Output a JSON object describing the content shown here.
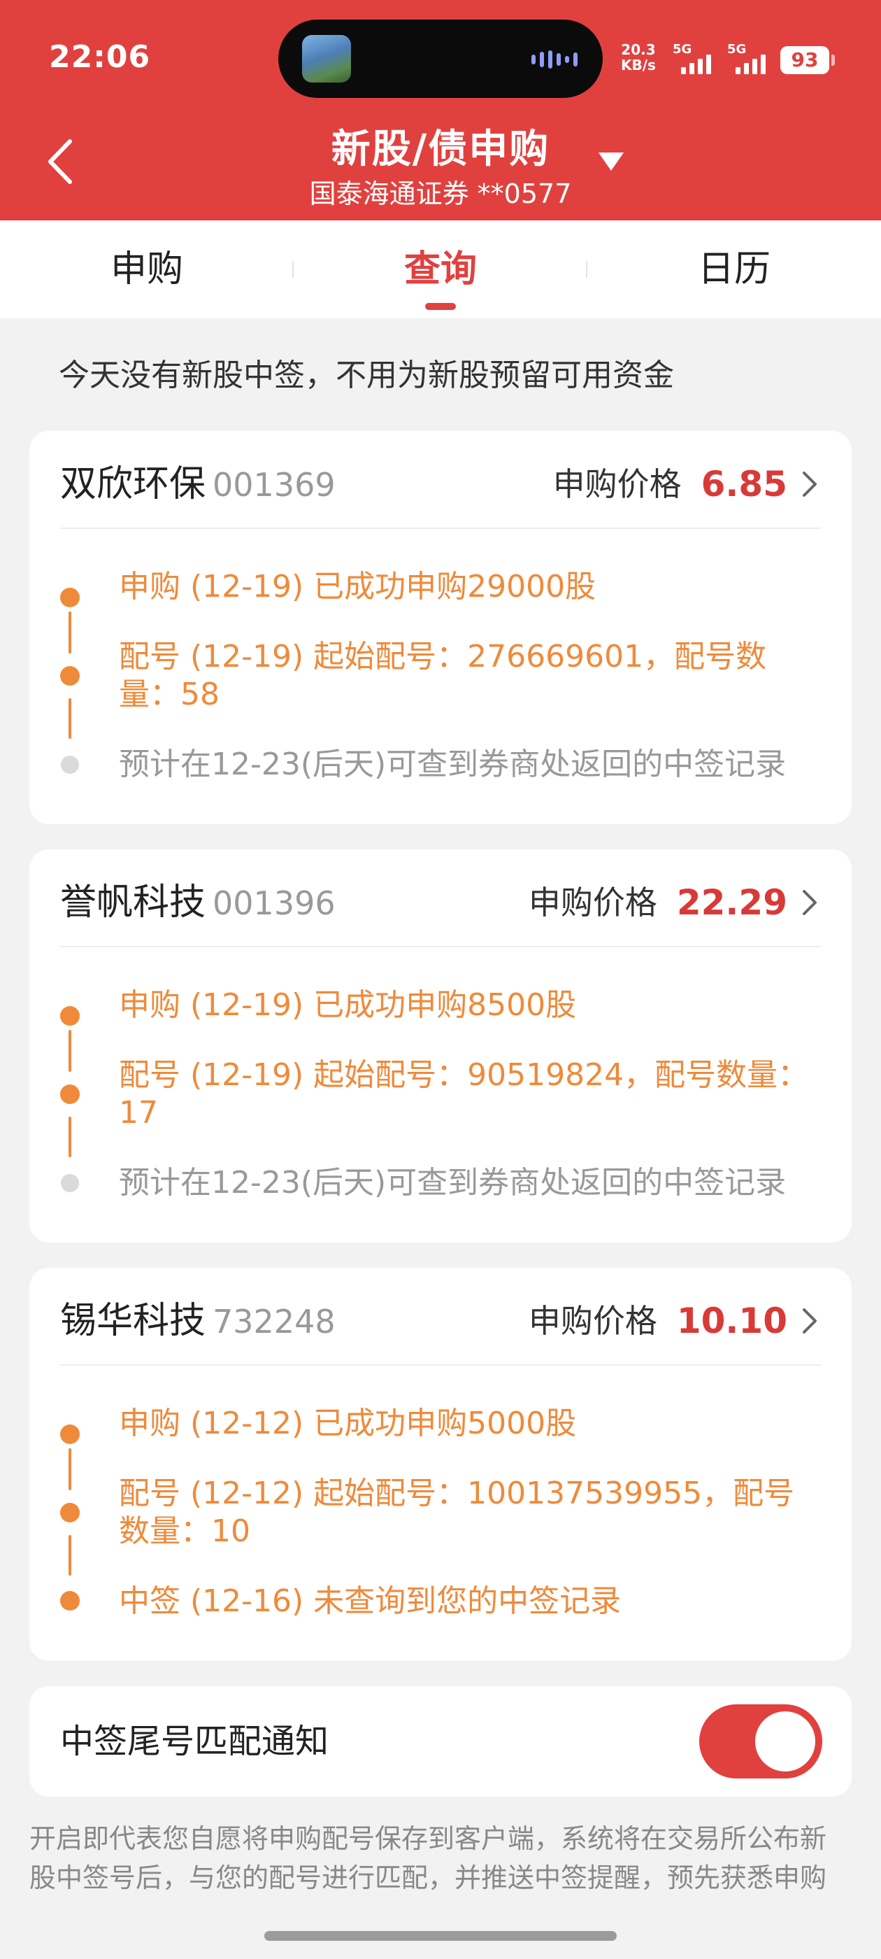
{
  "status": {
    "time": "22:06",
    "net_speed_value": "20.3",
    "net_speed_unit": "KB/s",
    "signal1": "5G",
    "signal2": "5G",
    "battery": "93"
  },
  "header": {
    "title": "新股/债申购",
    "account": "国泰海通证券 **0577"
  },
  "tabs": [
    {
      "label": "申购"
    },
    {
      "label": "查询"
    },
    {
      "label": "日历"
    }
  ],
  "notice": "今天没有新股中签，不用为新股预留可用资金",
  "cards": [
    {
      "name": "双欣环保",
      "code": "001369",
      "price_label": "申购价格",
      "price": "6.85",
      "steps": [
        "申购 (12-19) 已成功申购29000股",
        "配号 (12-19) 起始配号：276669601，配号数量：58",
        "预计在12-23(后天)可查到券商处返回的中签记录"
      ]
    },
    {
      "name": "誉帆科技",
      "code": "001396",
      "price_label": "申购价格",
      "price": "22.29",
      "steps": [
        "申购 (12-19) 已成功申购8500股",
        "配号 (12-19) 起始配号：90519824，配号数量：17",
        "预计在12-23(后天)可查到券商处返回的中签记录"
      ]
    },
    {
      "name": "锡华科技",
      "code": "732248",
      "price_label": "申购价格",
      "price": "10.10",
      "steps": [
        "申购 (12-12) 已成功申购5000股",
        "配号 (12-12) 起始配号：100137539955，配号数量：10",
        "中签 (12-16) 未查询到您的中签记录"
      ]
    }
  ],
  "toggle": {
    "label": "中签尾号匹配通知",
    "on": true
  },
  "disclaimer": "开启即代表您自愿将申购配号保存到客户端，系统将在交易所公布新股中签号后，与您的配号进行匹配，并推送中签提醒，预先获悉申购中签结果，同时中签新股的缴款、上市、开板提醒也将"
}
